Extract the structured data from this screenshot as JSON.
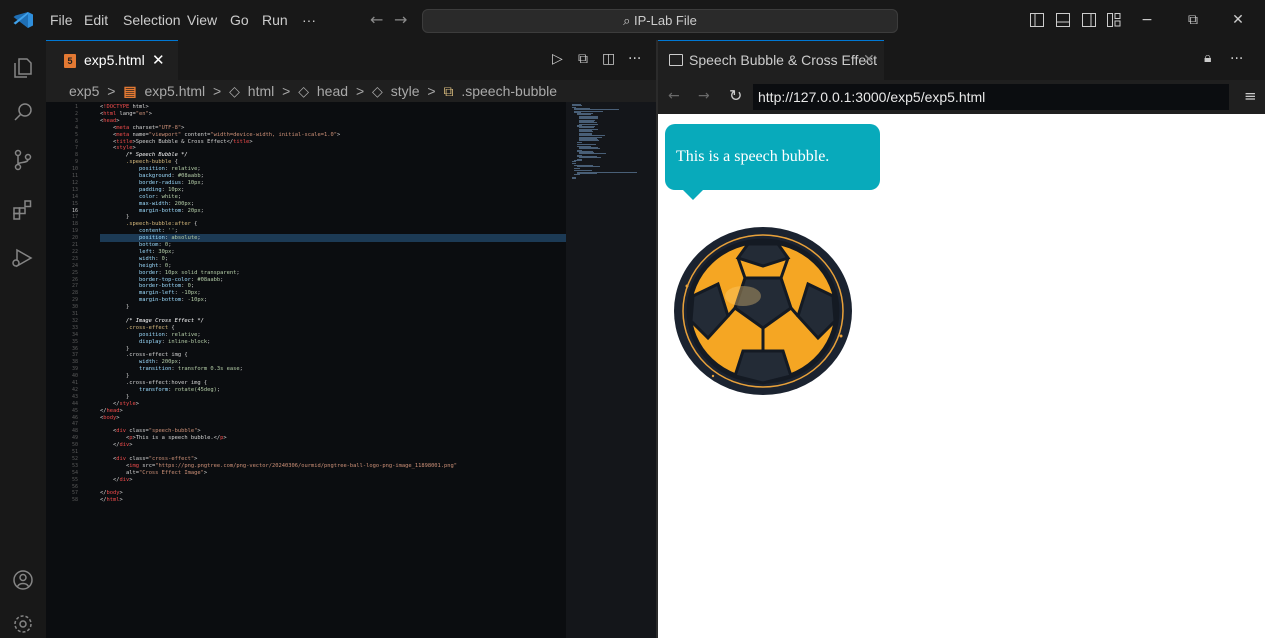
{
  "titlebar": {
    "menu": [
      "File",
      "Edit",
      "Selection",
      "View",
      "Go",
      "Run",
      "···"
    ],
    "search_text": "IP-Lab File",
    "minimize_label": "−",
    "restore_label": "⧉",
    "close_label": "✕"
  },
  "editor": {
    "tab_label": "exp5.html",
    "breadcrumbs": [
      "exp5",
      ">",
      "exp5.html",
      ">",
      "html",
      ">",
      "head",
      ">",
      "style",
      ">",
      ".speech-bubble"
    ],
    "code_lines": [
      "<!DOCTYPE html>",
      "<html lang=\"en\">",
      "<head>",
      "    <meta charset=\"UTF-8\">",
      "    <meta name=\"viewport\" content=\"width=device-width, initial-scale=1.0\">",
      "    <title>Speech Bubble & Cross Effect</title>",
      "    <style>",
      "        /* Speech Bubble */",
      "        .speech-bubble {",
      "            position: relative;",
      "            background: #08aabb;",
      "            border-radius: 10px;",
      "            padding: 10px;",
      "            color: white;",
      "            max-width: 200px;",
      "            margin-bottom: 20px;",
      "        }",
      "        .speech-bubble:after {",
      "            content: '';",
      "            position: absolute;",
      "            bottom: 0;",
      "            left: 30px;",
      "            width: 0;",
      "            height: 0;",
      "            border: 10px solid transparent;",
      "            border-top-color: #08aabb;",
      "            border-bottom: 0;",
      "            margin-left: -10px;",
      "            margin-bottom: -10px;",
      "        }",
      "",
      "        /* Image Cross Effect */",
      "        .cross-effect {",
      "            position: relative;",
      "            display: inline-block;",
      "        }",
      "        .cross-effect img {",
      "            width: 200px;",
      "            transition: transform 0.3s ease;",
      "        }",
      "        .cross-effect:hover img {",
      "            transform: rotate(45deg);",
      "        }",
      "    </style>",
      "</head>",
      "<body>",
      "",
      "    <div class=\"speech-bubble\">",
      "        <p>This is a speech bubble.</p>",
      "    </div>",
      "",
      "    <div class=\"cross-effect\">",
      "        <img src=\"https://png.pngtree.com/png-vector/20240306/ourmid/pngtree-ball-logo-png-image_11898001.png\"",
      "        alt=\"Cross Effect Image\">",
      "    </div>",
      "",
      "</body>",
      "</html>"
    ]
  },
  "preview": {
    "tab_label": "Speech Bubble & Cross Effect",
    "url": "http://127.0.0.1:3000/exp5/exp5.html",
    "bubble_text": "This is a speech bubble."
  },
  "colors": {
    "accent": "#0078d4",
    "bubble": "#08aabb",
    "ball_orange": "#f5a623"
  }
}
